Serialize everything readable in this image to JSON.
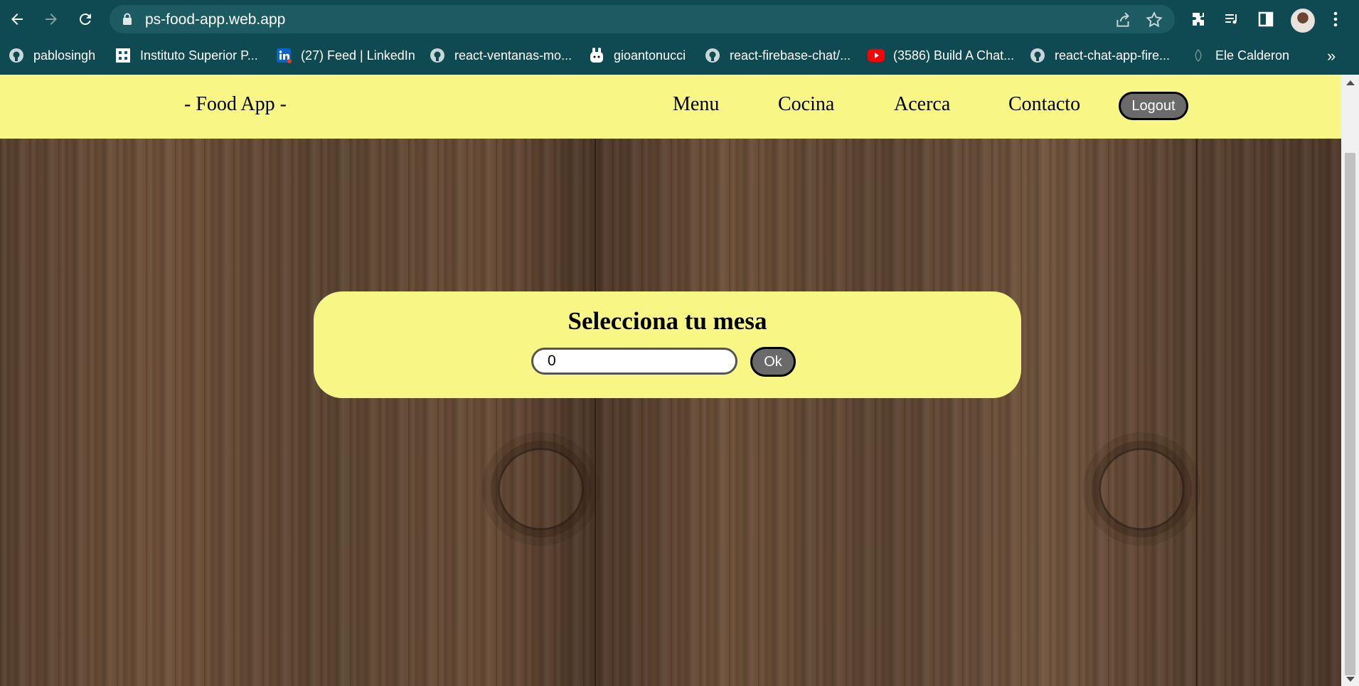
{
  "browser": {
    "url": "ps-food-app.web.app",
    "bookmarks": [
      {
        "label": "pablosingh",
        "icon": "github-icon"
      },
      {
        "label": "Instituto Superior P...",
        "icon": "institute-icon"
      },
      {
        "label": "(27) Feed | LinkedIn",
        "icon": "linkedin-icon"
      },
      {
        "label": "react-ventanas-mo...",
        "icon": "github-icon"
      },
      {
        "label": "gioantonucci",
        "icon": "bunny-icon"
      },
      {
        "label": "react-firebase-chat/...",
        "icon": "github-icon"
      },
      {
        "label": "(3586) Build A Chat...",
        "icon": "youtube-icon"
      },
      {
        "label": "react-chat-app-fire...",
        "icon": "github-icon"
      },
      {
        "label": "Ele Calderon",
        "icon": "leaf-icon"
      }
    ],
    "more_label": "»"
  },
  "navbar": {
    "brand": "- Food App -",
    "links": [
      "Menu",
      "Cocina",
      "Acerca",
      "Contacto"
    ],
    "logout_label": "Logout"
  },
  "table_card": {
    "title": "Selecciona tu mesa",
    "input_value": "0",
    "ok_label": "Ok"
  },
  "colors": {
    "navbar_bg": "#f8f786",
    "button_bg": "#6a6a6a",
    "chrome_bg": "#0f4a52"
  }
}
